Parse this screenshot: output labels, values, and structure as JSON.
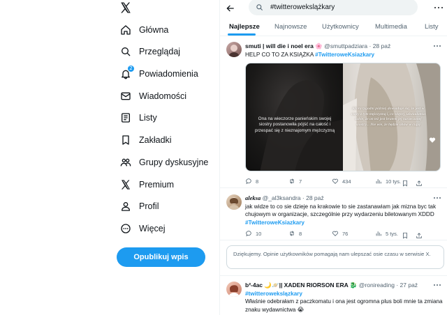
{
  "nav": {
    "items": [
      {
        "label": "Główna",
        "icon": "home-icon"
      },
      {
        "label": "Przeglądaj",
        "icon": "search-icon"
      },
      {
        "label": "Powiadomienia",
        "icon": "bell-icon",
        "badge": "2"
      },
      {
        "label": "Wiadomości",
        "icon": "envelope-icon"
      },
      {
        "label": "Listy",
        "icon": "list-icon"
      },
      {
        "label": "Zakładki",
        "icon": "bookmark-icon"
      },
      {
        "label": "Grupy dyskusyjne",
        "icon": "people-icon"
      },
      {
        "label": "Premium",
        "icon": "x-logo-icon"
      },
      {
        "label": "Profil",
        "icon": "person-icon"
      },
      {
        "label": "Więcej",
        "icon": "more-circle-icon"
      }
    ],
    "post_button": "Opublikuj wpis"
  },
  "search": {
    "value": "#twitterowekslążkary"
  },
  "tabs": [
    {
      "label": "Najlepsze",
      "active": true
    },
    {
      "label": "Najnowsze",
      "active": false
    },
    {
      "label": "Użytkownicy",
      "active": false
    },
    {
      "label": "Multimedia",
      "active": false
    },
    {
      "label": "Listy",
      "active": false
    }
  ],
  "tweets": [
    {
      "name": "smuti | will die i noel era 🌸",
      "handle": "@smuttpadziara",
      "date": "· 28 paź",
      "text": "HELP CO TO ZA KSIĄŻKA",
      "hashtag": "#TwitteroweKsiazkary",
      "media_caption_left": "Ona na wieczorze panieńskim swojej siostry postanowiła pójść na całość i przespać się z nieznajomym mężczyzną",
      "media_caption_right": "Która tygodni później dowiaduje się, że jest w ciąży z tym mężczyzną i, co więcej, uświadamia sobie, że on też jest bratem jej narzeczonej siostry... Nie wie, że będzie obaw w ciążę",
      "actions": {
        "replies": "8",
        "retweets": "7",
        "likes": "434",
        "views": "10 tys."
      }
    },
    {
      "name": "aleksa",
      "handle": "@_al3ksandra",
      "date": "· 28 paź",
      "text": "jak widze to co sie dzieje na krakowie to sie zastanawiam jak mizna byc tak chujowym w organizacje, szczególnie przy wydarzeniu biletowanym XDDD",
      "hashtag": "#TwitteroweKsiazkary",
      "actions": {
        "replies": "10",
        "retweets": "8",
        "likes": "76",
        "views": "5 tys."
      }
    },
    {
      "name": "b²-4ac 🌙🪐|| XADEN RIORSON ERA 🐉",
      "handle": "@ronireading",
      "date": "· 27 paź",
      "hashtag": "#twitterowekslązkary",
      "text": "Właśnie odebrałam z paczkomatu i ona jest ogromna plus boli mnie ta zmiana znaku wydawnictwa 😭"
    }
  ],
  "notice": "Dziękujemy. Opinie użytkowników pomagają nam ulepszać osie czasu w serwisie X.",
  "colors": {
    "accent": "#1d9bf0",
    "text": "#0f1419",
    "muted": "#536471",
    "border": "#eff3f4"
  }
}
